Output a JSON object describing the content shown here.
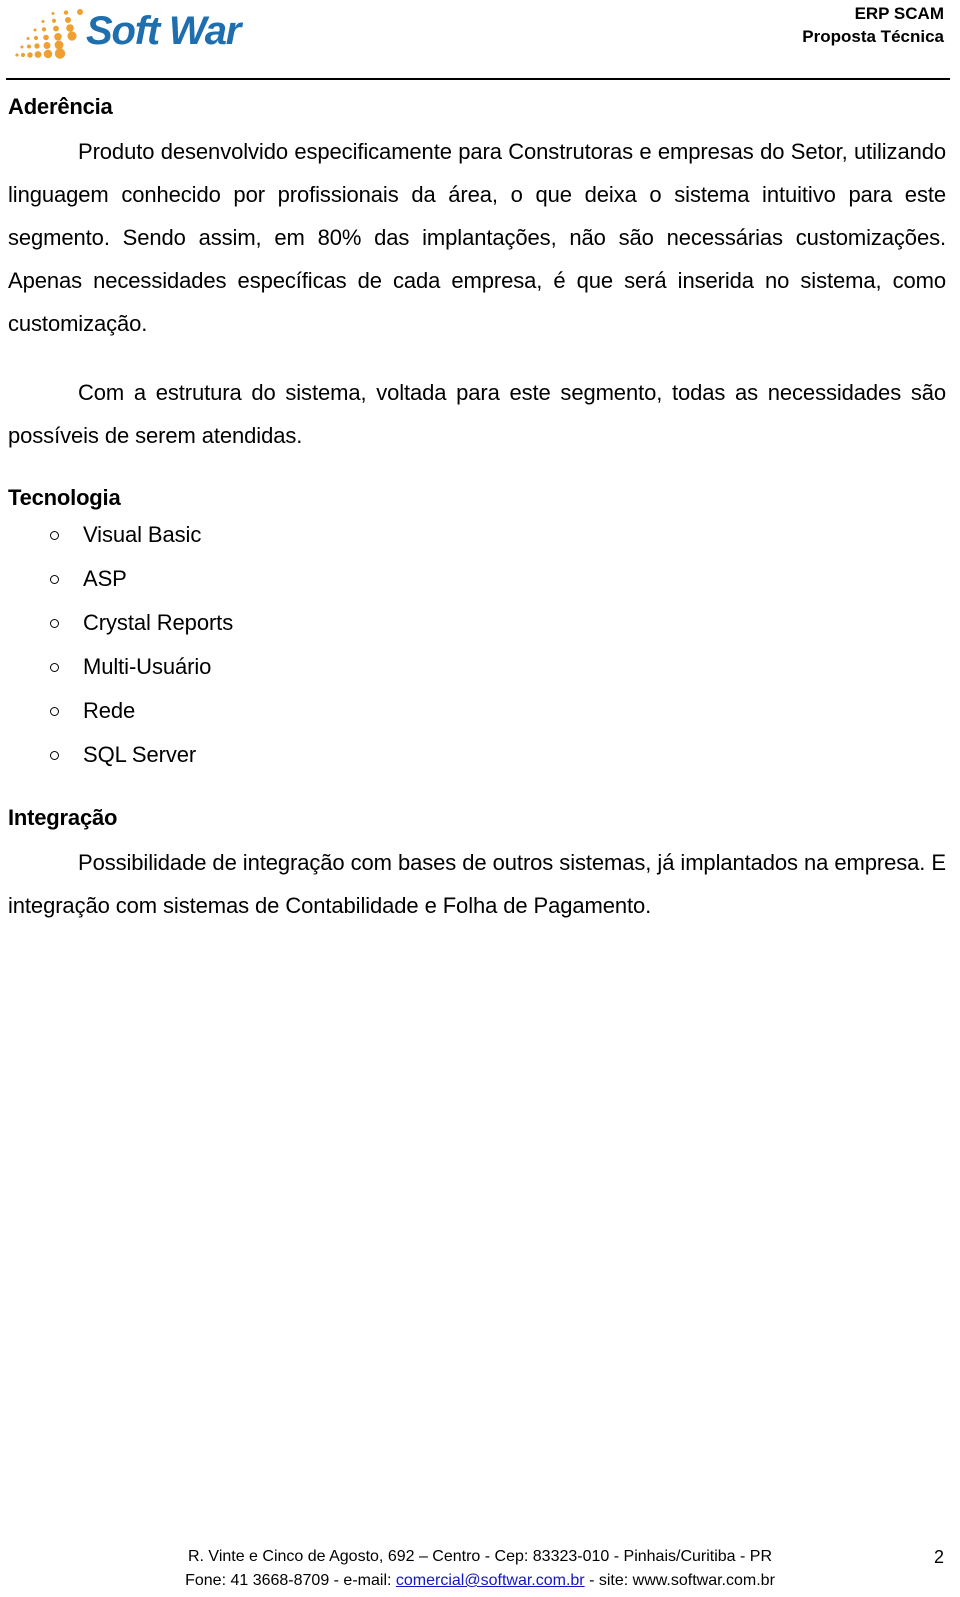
{
  "header": {
    "logo": {
      "icon": "softwar-dots-logo-icon",
      "wordmark": "Soft War",
      "brand_blue": "#1f6fae",
      "dot_orange": "#f0a030"
    },
    "title_line1": "ERP SCAM",
    "title_line2": "Proposta Técnica"
  },
  "content": {
    "section1": {
      "heading": "Aderência",
      "paragraph1": "Produto desenvolvido especificamente para Construtoras e empresas do Setor, utilizando linguagem conhecido por profissionais da área, o que deixa o sistema intuitivo para este segmento. Sendo assim, em 80% das implantações, não são necessárias customizações. Apenas necessidades específicas de cada empresa, é que será inserida no sistema, como customização.",
      "paragraph2": "Com a estrutura do sistema, voltada para este segmento, todas as necessidades são possíveis de serem atendidas."
    },
    "section2": {
      "heading": "Tecnologia",
      "items": [
        "Visual Basic",
        "ASP",
        "Crystal Reports",
        "Multi-Usuário",
        "Rede",
        "SQL Server"
      ]
    },
    "section3": {
      "heading": "Integração",
      "paragraph1": "Possibilidade de integração com bases de outros sistemas, já implantados na empresa. E integração com sistemas de Contabilidade e Folha de Pagamento."
    }
  },
  "footer": {
    "address_line": "R. Vinte e Cinco de Agosto, 692 – Centro - Cep: 83323-010 - Pinhais/Curitiba - PR",
    "contact_prefix": "Fone: 41 3668-8709 - e-mail: ",
    "email": "comercial@softwar.com.br",
    "contact_suffix": " - site: www.softwar.com.br",
    "page_number": "2",
    "link_color": "#1414c8"
  }
}
